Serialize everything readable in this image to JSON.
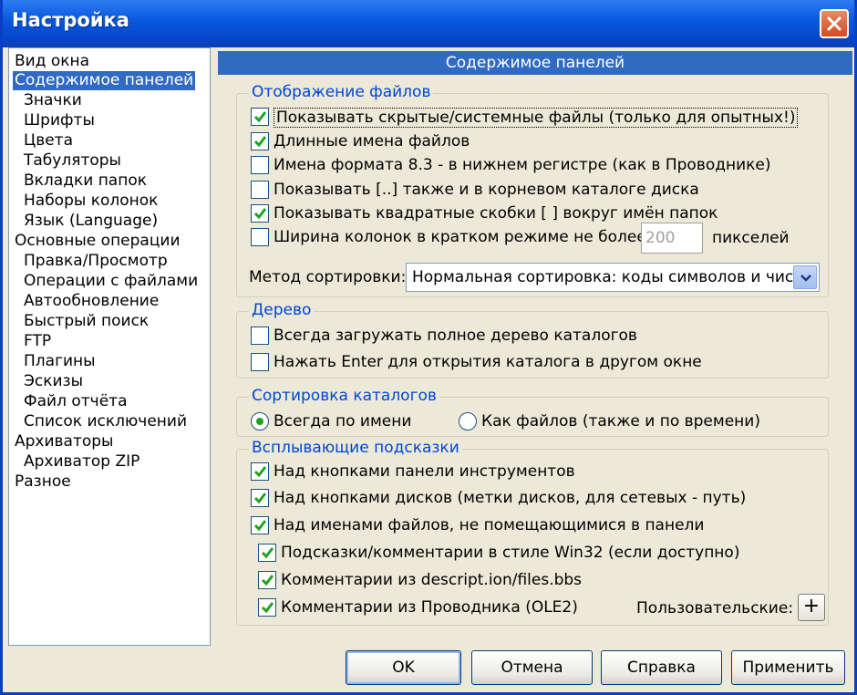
{
  "window": {
    "title": "Настройка"
  },
  "nav": {
    "items": [
      {
        "label": "Вид окна",
        "indent": 0,
        "selected": false
      },
      {
        "label": "Содержимое панелей",
        "indent": 0,
        "selected": true
      },
      {
        "label": "Значки",
        "indent": 1,
        "selected": false
      },
      {
        "label": "Шрифты",
        "indent": 1,
        "selected": false
      },
      {
        "label": "Цвета",
        "indent": 1,
        "selected": false
      },
      {
        "label": "Табуляторы",
        "indent": 1,
        "selected": false
      },
      {
        "label": "Вкладки папок",
        "indent": 1,
        "selected": false
      },
      {
        "label": "Наборы колонок",
        "indent": 1,
        "selected": false
      },
      {
        "label": "Язык (Language)",
        "indent": 1,
        "selected": false
      },
      {
        "label": "Основные операции",
        "indent": 0,
        "selected": false
      },
      {
        "label": "Правка/Просмотр",
        "indent": 1,
        "selected": false
      },
      {
        "label": "Операции с файлами",
        "indent": 1,
        "selected": false
      },
      {
        "label": "Автообновление",
        "indent": 1,
        "selected": false
      },
      {
        "label": "Быстрый поиск",
        "indent": 1,
        "selected": false
      },
      {
        "label": "FTP",
        "indent": 1,
        "selected": false
      },
      {
        "label": "Плагины",
        "indent": 1,
        "selected": false
      },
      {
        "label": "Эскизы",
        "indent": 1,
        "selected": false
      },
      {
        "label": "Файл отчёта",
        "indent": 1,
        "selected": false
      },
      {
        "label": "Список исключений",
        "indent": 1,
        "selected": false
      },
      {
        "label": "Архиваторы",
        "indent": 0,
        "selected": false
      },
      {
        "label": "Архиватор ZIP",
        "indent": 1,
        "selected": false
      },
      {
        "label": "Разное",
        "indent": 0,
        "selected": false
      }
    ]
  },
  "panel": {
    "header": "Содержимое панелей",
    "files_group": {
      "title": "Отображение файлов",
      "options": [
        {
          "label": "Показывать скрытые/системные файлы (только для опытных!)",
          "checked": true
        },
        {
          "label": "Длинные имена файлов",
          "checked": true
        },
        {
          "label": "Имена формата 8.3 - в нижнем регистре (как в Проводнике)",
          "checked": false
        },
        {
          "label": "Показывать [..] также и в корневом каталоге диска",
          "checked": false
        },
        {
          "label": "Показывать квадратные скобки [ ] вокруг имён папок",
          "checked": true
        },
        {
          "label": "Ширина колонок в кратком режиме не более:",
          "checked": false
        }
      ],
      "width_value": "200",
      "width_unit": "пикселей",
      "sort_label": "Метод сортировки:",
      "sort_value": "Нормальная сортировка: коды символов и числа"
    },
    "tree_group": {
      "title": "Дерево",
      "options": [
        {
          "label": "Всегда загружать полное дерево каталогов",
          "checked": false
        },
        {
          "label": "Нажать Enter для открытия каталога в другом окне",
          "checked": false
        }
      ]
    },
    "dir_sort_group": {
      "title": "Сортировка каталогов",
      "options": [
        {
          "label": "Всегда по имени",
          "selected": true
        },
        {
          "label": "Как файлов (также и по времени)",
          "selected": false
        }
      ]
    },
    "tooltips_group": {
      "title": "Всплывающие подсказки",
      "options": [
        {
          "label": "Над кнопками панели инструментов",
          "checked": true
        },
        {
          "label": "Над кнопками дисков (метки дисков, для сетевых - путь)",
          "checked": true
        },
        {
          "label": "Над именами файлов, не помещающимися в панели",
          "checked": true
        }
      ],
      "sub_options": [
        {
          "label": "Подсказки/комментарии в стиле Win32 (если доступно)",
          "checked": true
        },
        {
          "label": "Комментарии из descript.ion/files.bbs",
          "checked": true
        },
        {
          "label": "Комментарии из Проводника (OLE2)",
          "checked": true
        }
      ],
      "custom_label": "Пользовательские:",
      "custom_button": "+"
    }
  },
  "buttons": {
    "ok": "OK",
    "cancel": "Отмена",
    "help": "Справка",
    "apply": "Применить"
  },
  "colors": {
    "titlebar": "#0a5ae0",
    "selection": "#316ac5",
    "group_title": "#0046d5",
    "check": "#21a121",
    "dialog_bg": "#ece9d8"
  }
}
